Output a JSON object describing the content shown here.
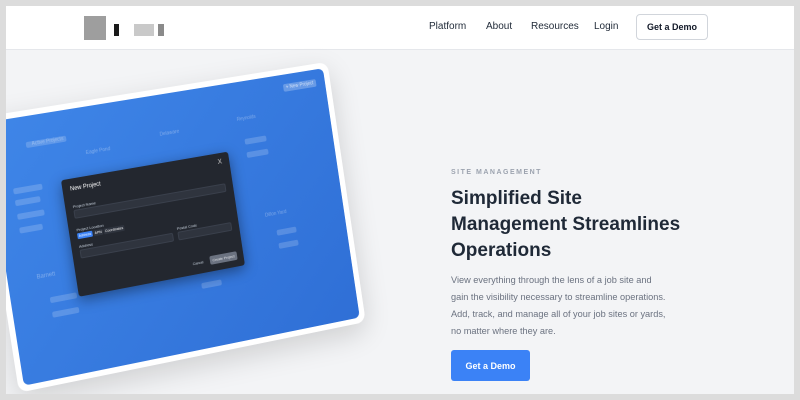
{
  "nav": {
    "links": [
      "Platform",
      "About",
      "Resources",
      "Login"
    ],
    "demo_label": "Get a Demo"
  },
  "mockup": {
    "modal_title": "New Project",
    "close_symbol": "X",
    "project_name_label": "Project Name",
    "project_location_label": "Project Location",
    "location_options": [
      "Address",
      "APN",
      "Coordinates"
    ],
    "address_label": "Address",
    "postal_code_label": "Postal Code",
    "cancel_label": "Cancel",
    "create_label": "Create Project",
    "bg_labels": [
      "Active Projects",
      "Eagle Pond",
      "Delaware",
      "Reynolds",
      "Barnett",
      "Dillon Yard"
    ],
    "corner_button": "+ New Project"
  },
  "hero": {
    "eyebrow": "SITE MANAGEMENT",
    "headline": "Simplified Site Management Streamlines Operations",
    "description": "View everything through the lens of a job site and gain the visibility necessary to streamline operations. Add, track, and manage all of your job sites or yards, no matter where they are.",
    "cta_label": "Get a Demo"
  },
  "colors": {
    "accent": "#3b82f6",
    "screen_blue": "#3f86e8",
    "modal_bg": "#23272f"
  },
  "icons": {
    "logo": "brand-logo-blurred",
    "close": "close-icon"
  }
}
